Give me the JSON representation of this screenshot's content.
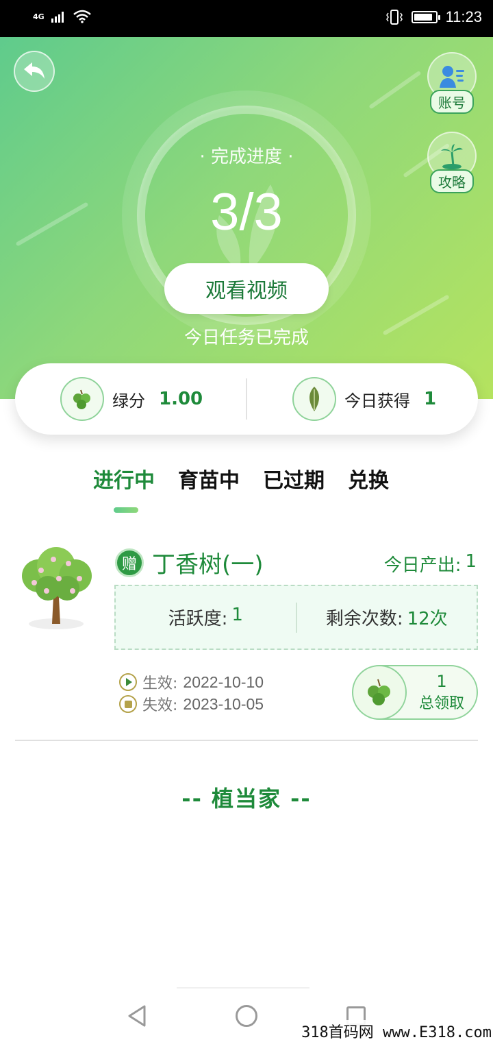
{
  "status_bar": {
    "network": "4G",
    "time": "11:23",
    "battery_level": 0.9
  },
  "header": {
    "account_label": "账号",
    "guide_label": "攻略"
  },
  "progress": {
    "title": "· 完成进度 ·",
    "value": "3/3",
    "watch_button": "观看视频",
    "status": "今日任务已完成"
  },
  "stats": {
    "green_points_label": "绿分",
    "green_points_value": "1.00",
    "today_earned_label": "今日获得",
    "today_earned_value": "1"
  },
  "tabs": [
    {
      "label": "进行中",
      "active": true
    },
    {
      "label": "育苗中",
      "active": false
    },
    {
      "label": "已过期",
      "active": false
    },
    {
      "label": "兑换",
      "active": false
    }
  ],
  "tree_item": {
    "badge": "赠",
    "name": "丁香树(一)",
    "today_output_label": "今日产出:",
    "today_output_value": "1",
    "activity_label": "活跃度:",
    "activity_value": "1",
    "remaining_label": "剩余次数:",
    "remaining_value": "12次",
    "effective_label": "生效:",
    "effective_date": "2022-10-10",
    "expire_label": "失效:",
    "expire_date": "2023-10-05",
    "claim_count": "1",
    "claim_label": "总领取"
  },
  "footer": {
    "brand": "-- 植当家 --"
  },
  "watermark": "318首码网 www.E318.com",
  "colors": {
    "primary_green": "#1e8a3a",
    "hero_start": "#5fcb8c",
    "hero_end": "#b5e35f"
  }
}
